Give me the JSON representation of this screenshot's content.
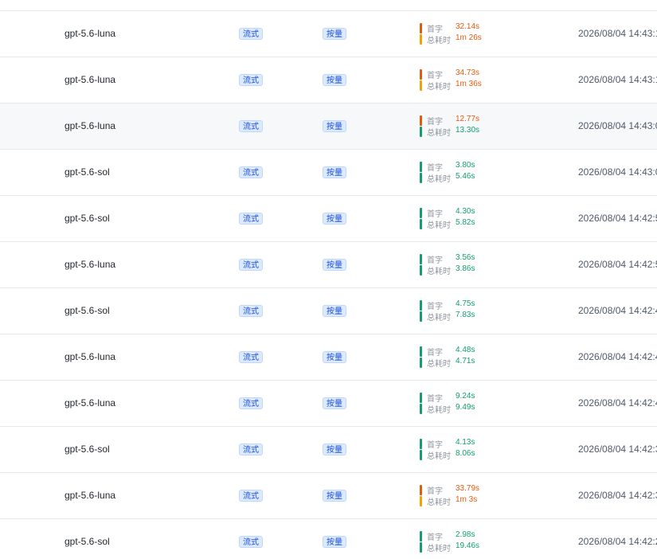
{
  "colors": {
    "slow": "#e8590c",
    "slow_bar": "#f59f00",
    "fast": "#12a06a",
    "fast_bar": "#12a06a"
  },
  "labels": {
    "first_token": "首字",
    "total_time": "总耗时"
  },
  "rows": [
    {
      "model": "gpt-5.6-luna",
      "stream": "流式",
      "billing": "按量",
      "first": "32.14s",
      "total": "1m 26s",
      "first_speed": "slow",
      "total_speed": "slow",
      "time": "2026/08/04 14:43:1"
    },
    {
      "model": "gpt-5.6-luna",
      "stream": "流式",
      "billing": "按量",
      "first": "34.73s",
      "total": "1m 36s",
      "first_speed": "slow",
      "total_speed": "slow",
      "time": "2026/08/04 14:43:1"
    },
    {
      "model": "gpt-5.6-luna",
      "stream": "流式",
      "billing": "按量",
      "first": "12.77s",
      "total": "13.30s",
      "first_speed": "slow",
      "total_speed": "fast",
      "time": "2026/08/04 14:43:0"
    },
    {
      "model": "gpt-5.6-sol",
      "stream": "流式",
      "billing": "按量",
      "first": "3.80s",
      "total": "5.46s",
      "first_speed": "fast",
      "total_speed": "fast",
      "time": "2026/08/04 14:43:0"
    },
    {
      "model": "gpt-5.6-sol",
      "stream": "流式",
      "billing": "按量",
      "first": "4.30s",
      "total": "5.82s",
      "first_speed": "fast",
      "total_speed": "fast",
      "time": "2026/08/04 14:42:5"
    },
    {
      "model": "gpt-5.6-luna",
      "stream": "流式",
      "billing": "按量",
      "first": "3.56s",
      "total": "3.86s",
      "first_speed": "fast",
      "total_speed": "fast",
      "time": "2026/08/04 14:42:5"
    },
    {
      "model": "gpt-5.6-sol",
      "stream": "流式",
      "billing": "按量",
      "first": "4.75s",
      "total": "7.83s",
      "first_speed": "fast",
      "total_speed": "fast",
      "time": "2026/08/04 14:42:4"
    },
    {
      "model": "gpt-5.6-luna",
      "stream": "流式",
      "billing": "按量",
      "first": "4.48s",
      "total": "4.71s",
      "first_speed": "fast",
      "total_speed": "fast",
      "time": "2026/08/04 14:42:4"
    },
    {
      "model": "gpt-5.6-luna",
      "stream": "流式",
      "billing": "按量",
      "first": "9.24s",
      "total": "9.49s",
      "first_speed": "fast",
      "total_speed": "fast",
      "time": "2026/08/04 14:42:4"
    },
    {
      "model": "gpt-5.6-sol",
      "stream": "流式",
      "billing": "按量",
      "first": "4.13s",
      "total": "8.06s",
      "first_speed": "fast",
      "total_speed": "fast",
      "time": "2026/08/04 14:42:3"
    },
    {
      "model": "gpt-5.6-luna",
      "stream": "流式",
      "billing": "按量",
      "first": "33.79s",
      "total": "1m 3s",
      "first_speed": "slow",
      "total_speed": "slow",
      "time": "2026/08/04 14:42:3"
    },
    {
      "model": "gpt-5.6-sol",
      "stream": "流式",
      "billing": "按量",
      "first": "2.98s",
      "total": "19.46s",
      "first_speed": "fast",
      "total_speed": "fast",
      "time": "2026/08/04 14:42:2"
    }
  ],
  "highlighted_row": 2
}
